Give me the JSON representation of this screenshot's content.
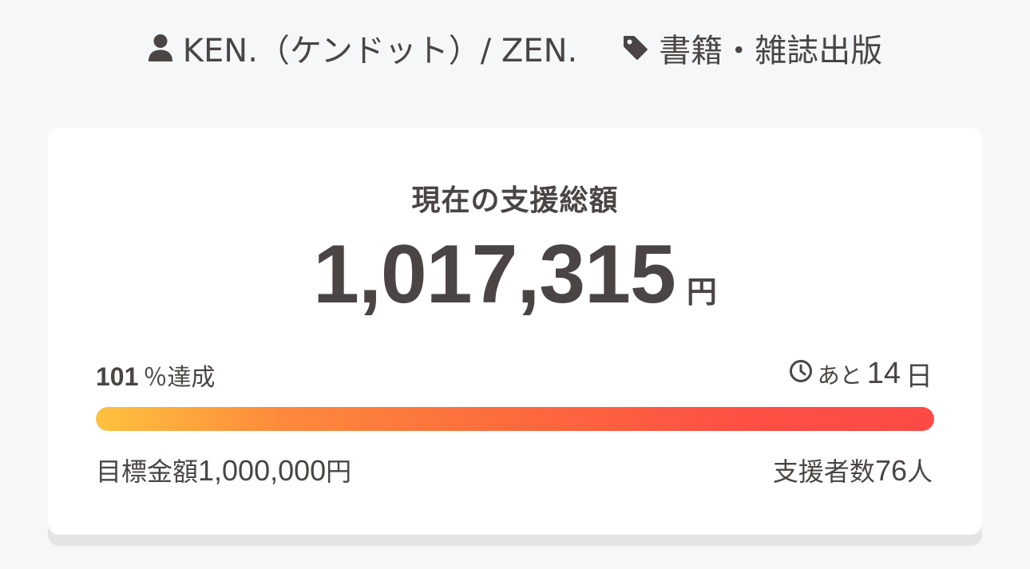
{
  "meta": {
    "author_icon": "user-icon",
    "author": "KEN.（ケンドット）/ ZEN.",
    "category_icon": "tag-icon",
    "category": "書籍・雑誌出版"
  },
  "funding": {
    "title": "現在の支援総額",
    "amount": "1,017,315",
    "currency": "円",
    "percent": "101",
    "percent_suffix": "％達成",
    "clock_icon": "clock-icon",
    "remaining_prefix": "あと",
    "remaining_days": "14",
    "remaining_suffix": "日",
    "progress_fraction": 1.0,
    "goal_label": "目標金額",
    "goal_amount": "1,000,000",
    "goal_currency": "円",
    "backers_label": "支援者数",
    "backers_count": "76",
    "backers_suffix": "人"
  },
  "colors": {
    "background": "#f5f7f9",
    "text": "#4a4544",
    "progress_start": "#ffc23e",
    "progress_end": "#ff4a47"
  }
}
